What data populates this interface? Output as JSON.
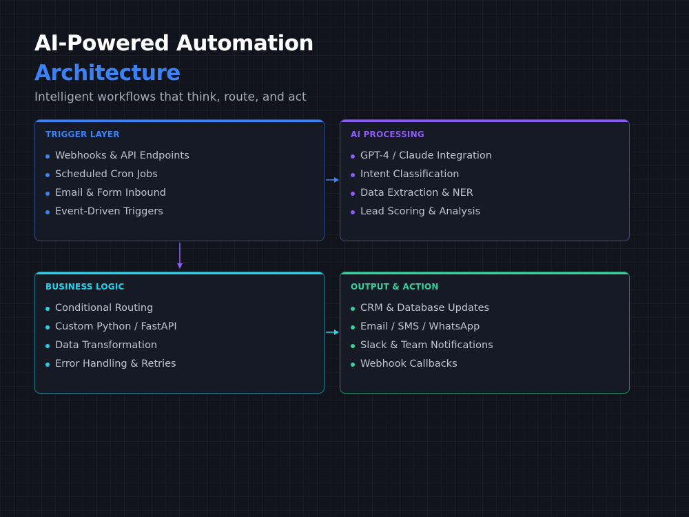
{
  "header": {
    "title": "AI-Powered Automation",
    "title_accent": "Architecture",
    "subtitle": "Intelligent workflows that think, route, and act"
  },
  "colors": {
    "background": "#11141c",
    "trigger": "#3b82f6",
    "ai": "#8b5cf6",
    "logic": "#22d3ee",
    "output": "#34d399"
  },
  "cards": [
    {
      "id": "trigger",
      "title": "TRIGGER LAYER",
      "items": [
        "Webhooks & API Endpoints",
        "Scheduled Cron Jobs",
        "Email & Form Inbound",
        "Event-Driven Triggers"
      ]
    },
    {
      "id": "ai",
      "title": "AI PROCESSING",
      "items": [
        "GPT-4 / Claude Integration",
        "Intent Classification",
        "Data Extraction & NER",
        "Lead Scoring & Analysis"
      ]
    },
    {
      "id": "logic",
      "title": "BUSINESS LOGIC",
      "items": [
        "Conditional Routing",
        "Custom Python / FastAPI",
        "Data Transformation",
        "Error Handling & Retries"
      ]
    },
    {
      "id": "output",
      "title": "OUTPUT & ACTION",
      "items": [
        "CRM & Database Updates",
        "Email / SMS / WhatsApp",
        "Slack & Team Notifications",
        "Webhook Callbacks"
      ]
    }
  ],
  "connectors": [
    {
      "from": "trigger",
      "to": "ai",
      "icon": "arrow-right-icon"
    },
    {
      "from": "trigger",
      "to": "logic",
      "icon": "arrow-down-icon"
    },
    {
      "from": "logic",
      "to": "output",
      "icon": "arrow-right-icon"
    }
  ]
}
